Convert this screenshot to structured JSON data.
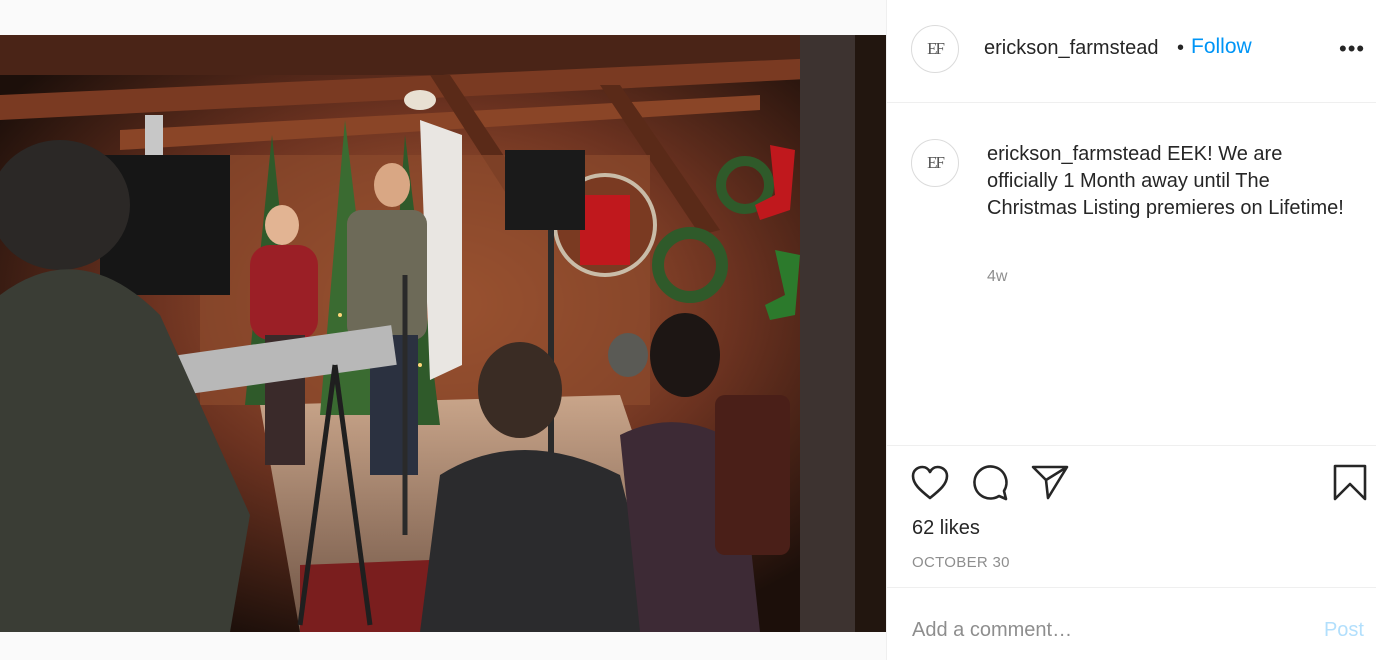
{
  "post": {
    "author": "erickson_farmstead",
    "avatar_initials": "EF",
    "follow_label": "Follow",
    "separator": "•",
    "more_glyph": "•••",
    "caption": "EEK! We are officially 1 Month away until The Christmas Listing premieres on Lifetime!",
    "time_ago": "4w",
    "likes": "62 likes",
    "date": "OCTOBER 30"
  },
  "comment_box": {
    "placeholder": "Add a comment…",
    "post_label": "Post"
  },
  "icons": {
    "like": "heart-icon",
    "comment": "comment-bubble-icon",
    "share": "paper-plane-icon",
    "save": "bookmark-icon",
    "more": "more-options-icon"
  },
  "colors": {
    "link_blue": "#0095f6",
    "post_disabled": "#b2dffc",
    "muted": "#8e8e8e",
    "text": "#262626"
  }
}
